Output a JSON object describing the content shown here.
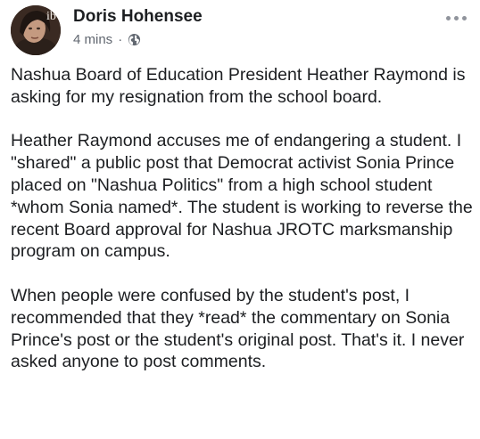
{
  "post": {
    "author_name": "Doris Hohensee",
    "timestamp": "4 mins",
    "separator": "·",
    "privacy_icon": "globe-icon",
    "avatar_overlay_text": "ib",
    "more_icon": "more-horizontal-icon",
    "paragraphs": [
      "Nashua Board of Education President Heather Raymond is asking for my resignation from the school board.",
      "Heather Raymond accuses me of endangering a student. I \"shared\" a public post that Democrat activist Sonia Prince placed on \"Nashua Politics\" from a high school student *whom Sonia named*. The student is working to reverse the recent Board approval for Nashua JROTC marksmanship program on campus.",
      "When people were confused by the student's post, I recommended that they *read* the commentary on Sonia Prince's post or the student's original post. That's it. I never asked anyone to post comments."
    ]
  }
}
